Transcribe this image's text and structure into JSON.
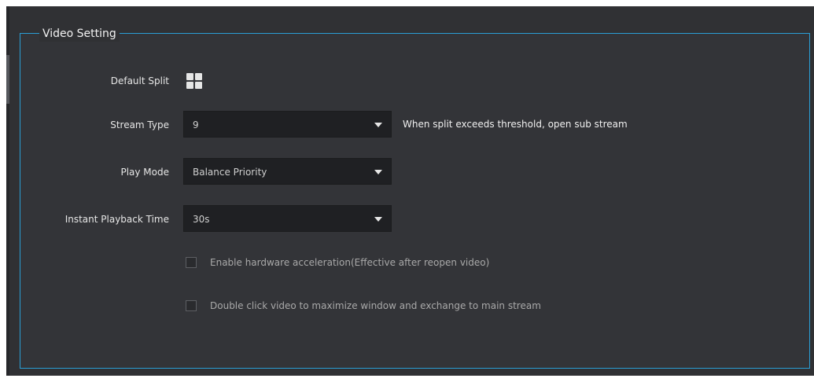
{
  "group": {
    "title": "Video Setting"
  },
  "default_split": {
    "label": "Default Split",
    "icon": "grid-2x2-icon"
  },
  "stream_type": {
    "label": "Stream Type",
    "value": "9",
    "hint": "When split exceeds threshold, open sub stream"
  },
  "play_mode": {
    "label": "Play Mode",
    "value": "Balance Priority"
  },
  "instant_playback": {
    "label": "Instant Playback Time",
    "value": "30s"
  },
  "options": [
    {
      "label": "Enable hardware acceleration(Effective after reopen video)",
      "checked": false
    },
    {
      "label": "Double click video to maximize window and exchange to main stream",
      "checked": false
    }
  ],
  "colors": {
    "accent": "#2a9fd6",
    "panel": "#303134",
    "input": "#1f2023"
  }
}
